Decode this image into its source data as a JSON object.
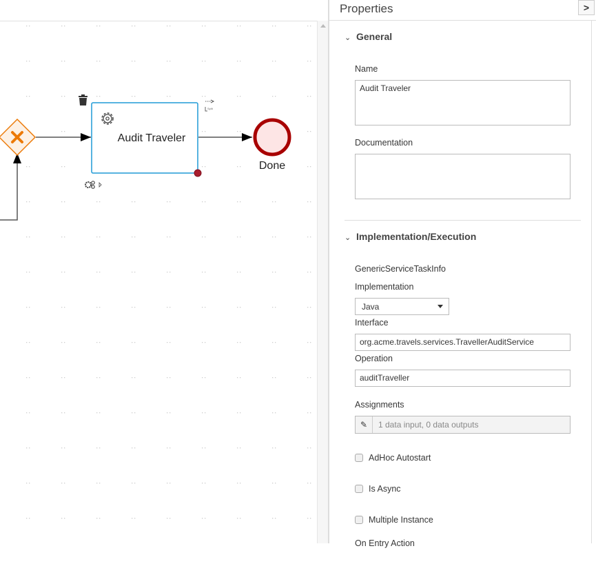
{
  "canvas": {
    "task": {
      "name": "Audit Traveler",
      "icon": "gear-icon",
      "border_color": "#1e9ad6"
    },
    "end_event": {
      "label": "Done",
      "color": "#a80000",
      "fill": "#fde5e5"
    },
    "gateway": {
      "type": "exclusive",
      "color": "#ec7a08",
      "fill": "#fdf1e5"
    },
    "toolbox": {
      "delete_icon": "trash-icon",
      "connector_icon": "arrow-icon",
      "split_label": "Split",
      "morph_icon": "gears-icon"
    }
  },
  "properties": {
    "title": "Properties",
    "collapse_button": ">",
    "general": {
      "title": "General",
      "name_label": "Name",
      "name_value": "Audit Traveler",
      "documentation_label": "Documentation",
      "documentation_value": ""
    },
    "implementation": {
      "title": "Implementation/Execution",
      "info_label": "GenericServiceTaskInfo",
      "implementation_label": "Implementation",
      "implementation_value": "Java",
      "interface_label": "Interface",
      "interface_value": "org.acme.travels.services.TravellerAuditService",
      "operation_label": "Operation",
      "operation_value": "auditTraveller",
      "assignments_label": "Assignments",
      "assignments_value": "1 data input, 0 data outputs",
      "adhoc_label": "AdHoc Autostart",
      "adhoc_checked": false,
      "async_label": "Is Async",
      "async_checked": false,
      "multiple_label": "Multiple Instance",
      "multiple_checked": false,
      "on_entry_label": "On Entry Action"
    }
  }
}
